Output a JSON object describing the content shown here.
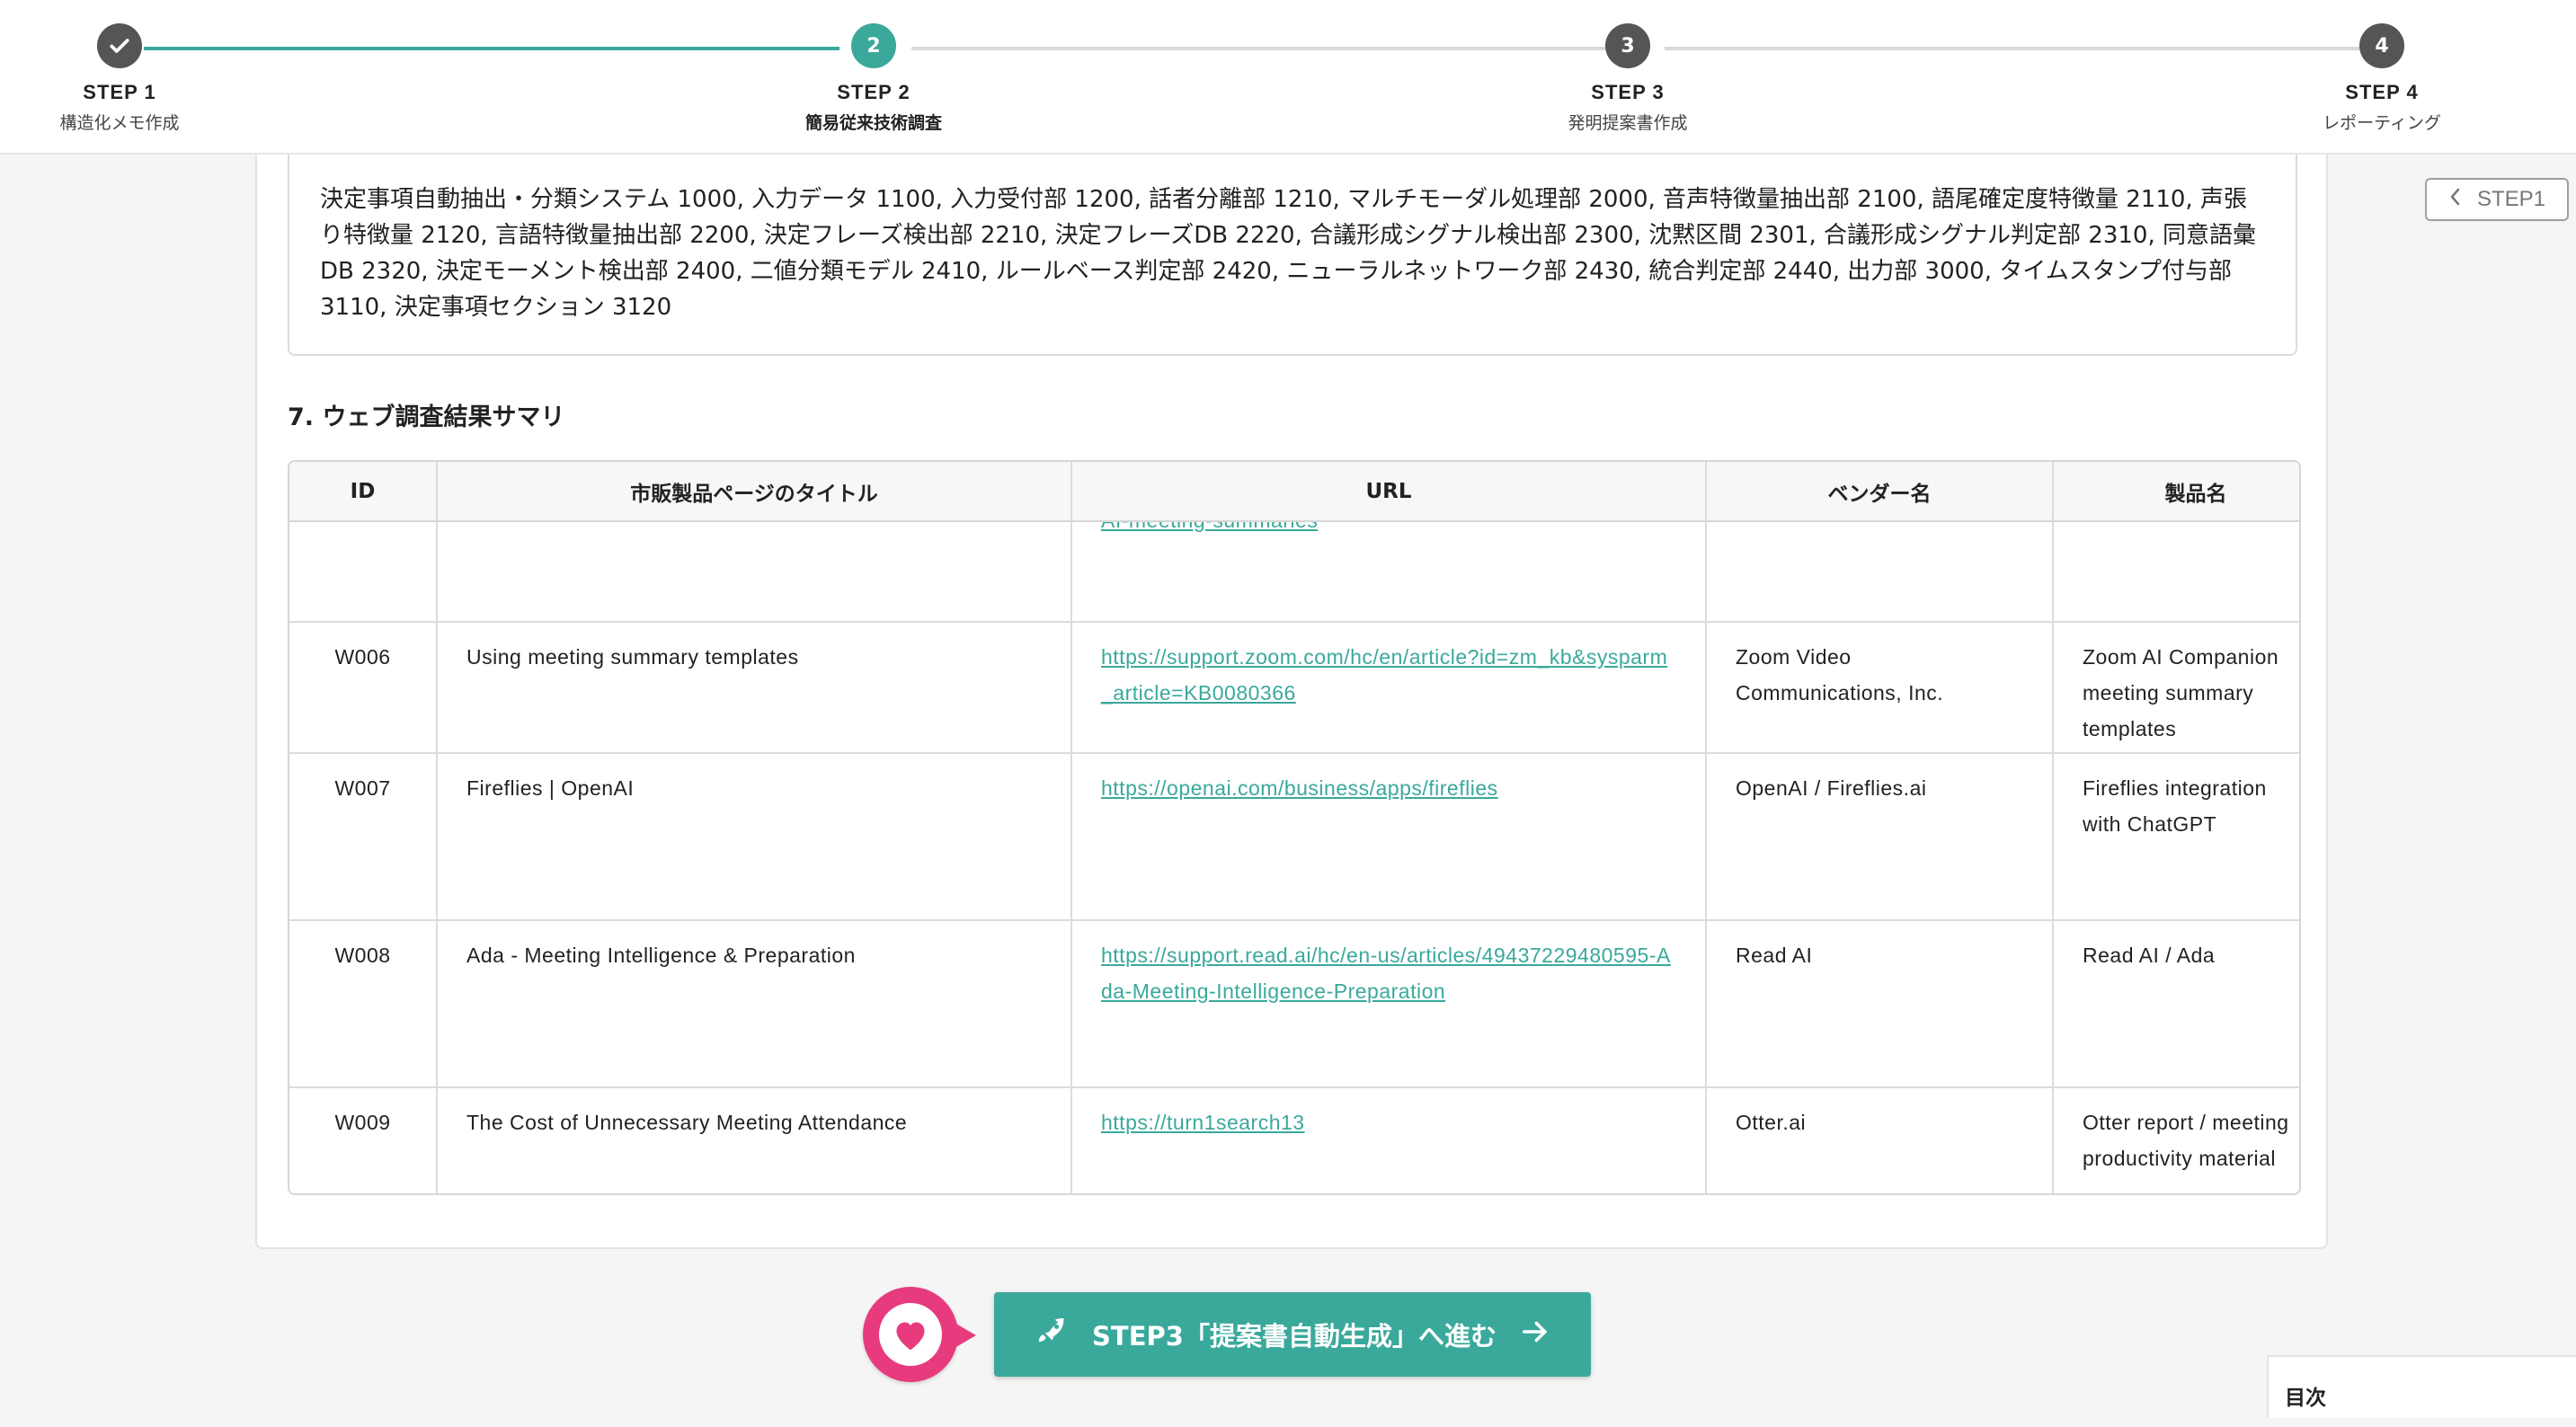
{
  "stepper": {
    "steps": [
      {
        "number": "",
        "title": "STEP 1",
        "sub": "構造化メモ作成",
        "state": "done"
      },
      {
        "number": "2",
        "title": "STEP 2",
        "sub": "簡易従来技術調査",
        "state": "active"
      },
      {
        "number": "3",
        "title": "STEP 3",
        "sub": "発明提案書作成",
        "state": "pending"
      },
      {
        "number": "4",
        "title": "STEP 4",
        "sub": "レポーティング",
        "state": "pending"
      }
    ]
  },
  "components_text": "決定事項自動抽出・分類システム 1000, 入力データ 1100, 入力受付部 1200, 話者分離部 1210, マルチモーダル処理部 2000, 音声特徴量抽出部 2100, 語尾確定度特徴量 2110, 声張り特徴量 2120, 言語特徴量抽出部 2200, 決定フレーズ検出部 2210, 決定フレーズDB 2220, 合議形成シグナル検出部 2300, 沈黙区間 2301, 合議形成シグナル判定部 2310, 同意語彙DB 2320, 決定モーメント検出部 2400, 二値分類モデル 2410, ルールベース判定部 2420, ニューラルネットワーク部 2430, 統合判定部 2440, 出力部 3000, タイムスタンプ付与部 3110, 決定事項セクション 3120",
  "section_title": "7. ウェブ調査結果サマリ",
  "table": {
    "headers": [
      "ID",
      "市販製品ページのタイトル",
      "URL",
      "ベンダー名",
      "製品名"
    ],
    "partial_row": {
      "url": "AI-meeting-summaries"
    },
    "rows": [
      {
        "id": "W006",
        "title": "Using meeting summary templates",
        "url": "https://support.zoom.com/hc/en/article?id=zm_kb&sysparm_article=KB0080366",
        "vendor": "Zoom Video Communications, Inc.",
        "product": "Zoom AI Companion meeting summary templates"
      },
      {
        "id": "W007",
        "title": "Fireflies | OpenAI",
        "url": "https://openai.com/business/apps/fireflies",
        "vendor": "OpenAI / Fireflies.ai",
        "product": "Fireflies integration with ChatGPT"
      },
      {
        "id": "W008",
        "title": "Ada - Meeting Intelligence & Preparation",
        "url": "https://support.read.ai/hc/en-us/articles/49437229480595-Ada-Meeting-Intelligence-Preparation",
        "vendor": "Read AI",
        "product": "Read AI / Ada"
      },
      {
        "id": "W009",
        "title": "The Cost of Unnecessary Meeting Attendance",
        "url": "https://turn1search13",
        "vendor": "Otter.ai",
        "product": "Otter report / meeting productivity material"
      }
    ]
  },
  "side": {
    "step1_label": "STEP1",
    "toc_label": "目次"
  },
  "cta": {
    "label": "STEP3「提案書自動生成」へ進む"
  },
  "colors": {
    "accent": "#3aa99b",
    "pink": "#e73b7d",
    "dark_step": "#555555"
  }
}
